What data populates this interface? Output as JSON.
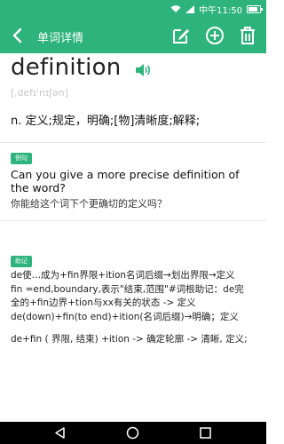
{
  "status": {
    "carrier": "中午11:50",
    "battery_level": 0.85
  },
  "appbar": {
    "title": "单词详情"
  },
  "entry": {
    "word": "definition",
    "phonetic": "[ˌdefɪˈnɪʃən]",
    "definition": "n. 定义;规定，明确;[物]清晰度;解释;"
  },
  "example": {
    "tag": "例句",
    "english": "Can you give a more precise definition of the word?",
    "chinese": "你能给这个词下个更确切的定义吗？"
  },
  "mnemonic": {
    "tag": "助记",
    "lines": [
      "de使…成为+fin界限+ition名词后缀→划出界限→定义",
      "fin =end,boundary,表示\"结束,范围\"#词根助记：de完",
      "全的+fin边界+tion与xx有关的状态 -> 定义",
      "de(down)+fin(to end)+ition(名词后缀)→明确；定义",
      "de+fin ( 界限, 结束) +ition -> 确定轮廓 -> 清晰, 定义;"
    ]
  }
}
